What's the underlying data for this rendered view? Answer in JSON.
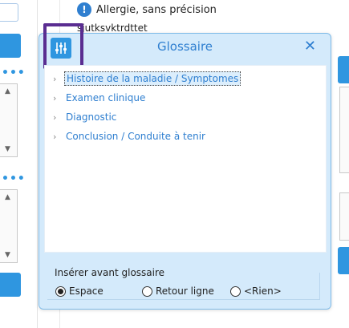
{
  "background": {
    "alert_text": "Allergie, sans précision",
    "code_text": "sjutksvktrdttet"
  },
  "dialog": {
    "title": "Glossaire",
    "close_glyph": "✕",
    "tree_items": [
      {
        "label": "Histoire de la maladie / Symptomes",
        "selected": true
      },
      {
        "label": "Examen clinique",
        "selected": false
      },
      {
        "label": "Diagnostic",
        "selected": false
      },
      {
        "label": "Conclusion / Conduite à tenir",
        "selected": false
      }
    ],
    "insert_group": {
      "title": "Insérer avant glossaire",
      "options": [
        {
          "label": "Espace",
          "checked": true
        },
        {
          "label": "Retour ligne",
          "checked": false
        },
        {
          "label": "<Rien>",
          "checked": false
        }
      ]
    }
  },
  "colors": {
    "accent": "#2f96e0",
    "title_text": "#2f7fd0",
    "dialog_bg": "#d4eafb",
    "highlight": "#5a2d91"
  },
  "icons": {
    "settings": "sliders-icon",
    "close": "close-icon",
    "warning": "info-warning-icon",
    "tree_chevron": "chevron-right-icon"
  }
}
